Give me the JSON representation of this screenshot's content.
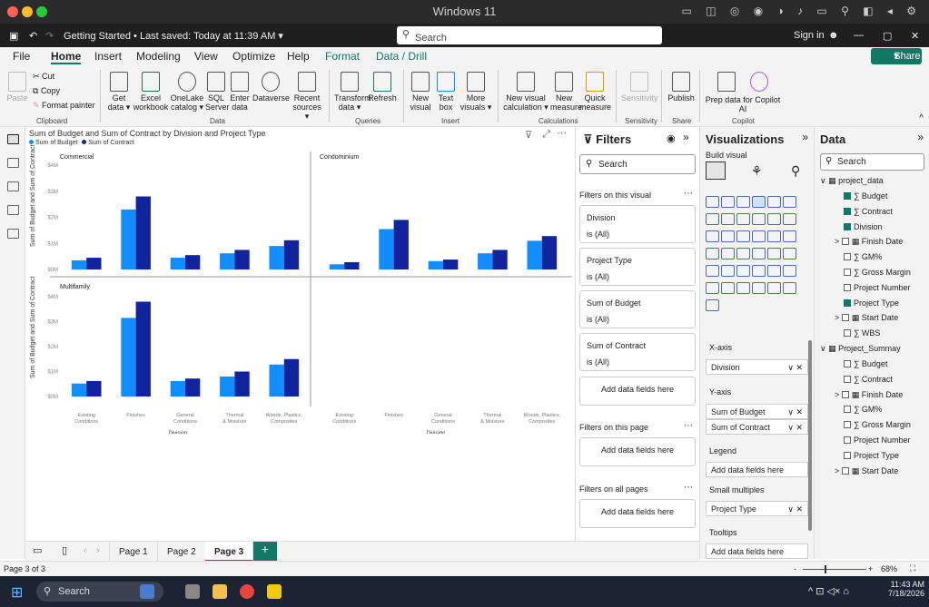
{
  "os": {
    "window_title": "Windows 11"
  },
  "title_bar": {
    "file_title": "Getting Started • Last saved: Today at 11:39 AM ▾",
    "search": "Search",
    "sign_in": "Sign in"
  },
  "menu": {
    "tabs": [
      "File",
      "Home",
      "Insert",
      "Modeling",
      "View",
      "Optimize",
      "Help",
      "Format",
      "Data / Drill"
    ],
    "share": "Share"
  },
  "ribbon": {
    "clipboard": {
      "paste": "Paste",
      "cut": "Cut",
      "copy": "Copy",
      "format_painter": "Format painter",
      "group": "Clipboard"
    },
    "data": {
      "get_data": "Get data ▾",
      "excel": "Excel workbook",
      "onelake": "OneLake catalog ▾",
      "sql": "SQL Server",
      "enter": "Enter data",
      "dataverse": "Dataverse",
      "recent": "Recent sources ▾",
      "group": "Data"
    },
    "queries": {
      "transform": "Transform data ▾",
      "refresh": "Refresh",
      "group": "Queries"
    },
    "insert": {
      "new_visual": "New visual",
      "text_box": "Text box",
      "more": "More visuals ▾",
      "group": "Insert"
    },
    "calcs": {
      "new_visual_calc": "New visual calculation ▾",
      "new_measure": "New measure",
      "quick_measure": "Quick measure",
      "group": "Calculations"
    },
    "sensitivity": {
      "label": "Sensitivity",
      "group": "Sensitivity"
    },
    "share": {
      "publish": "Publish",
      "group": "Share"
    },
    "copilot": {
      "prep": "Prep data for Copilot",
      "ai": "AI",
      "group": "Copilot"
    }
  },
  "chart_data": {
    "type": "bar",
    "title": "Sum of Budget and Sum of Contract by Division and Project Type",
    "ylabel": "Sum of Budget and Sum of Contract",
    "xlabel": "Division",
    "ylim": [
      0,
      4
    ],
    "yticks": [
      "$0M",
      "$1M",
      "$2M",
      "$3M",
      "$4M"
    ],
    "categories": [
      "Existing Conditions",
      "Finishes",
      "General Conditions",
      "Thermal & Moisture",
      "Woods, Plastics, Composites"
    ],
    "series_names": [
      "Sum of Budget",
      "Sum of Contract"
    ],
    "colors": [
      "#118dff",
      "#12239e"
    ],
    "panels": [
      {
        "name": "Commercial",
        "budget": [
          0.35,
          2.3,
          0.45,
          0.62,
          0.9
        ],
        "contract": [
          0.45,
          2.8,
          0.55,
          0.75,
          1.12
        ]
      },
      {
        "name": "Condominium",
        "budget": [
          0.2,
          1.55,
          0.32,
          0.62,
          1.1
        ],
        "contract": [
          0.28,
          1.9,
          0.38,
          0.75,
          1.28
        ]
      },
      {
        "name": "Multifamily",
        "budget": [
          0.52,
          3.15,
          0.62,
          0.8,
          1.28
        ],
        "contract": [
          0.62,
          3.8,
          0.72,
          1.0,
          1.5
        ]
      }
    ]
  },
  "filters": {
    "title": "Filters",
    "on_visual": "Filters on this visual",
    "cards": [
      {
        "name": "Division",
        "value": "is (All)"
      },
      {
        "name": "Project Type",
        "value": "is (All)"
      },
      {
        "name": "Sum of Budget",
        "value": "is (All)"
      },
      {
        "name": "Sum of Contract",
        "value": "is (All)"
      }
    ],
    "add": "Add data fields here",
    "on_page": "Filters on this page",
    "on_all": "Filters on all pages",
    "search": "Search"
  },
  "visualizations": {
    "title": "Visualizations",
    "build": "Build visual",
    "xaxis": "X-axis",
    "xaxis_field": "Division",
    "yaxis": "Y-axis",
    "y1": "Sum of Budget",
    "y2": "Sum of Contract",
    "legend": "Legend",
    "add": "Add data fields here",
    "small_multiples": "Small multiples",
    "sm_field": "Project Type",
    "tooltips": "Tooltips",
    "add2": "Add data fields here"
  },
  "data": {
    "title": "Data",
    "search": "Search",
    "tables": [
      {
        "name": "project_data",
        "fields": [
          {
            "label": "∑ Budget",
            "checked": true
          },
          {
            "label": "∑ Contract",
            "checked": true
          },
          {
            "label": "Division",
            "checked": true
          },
          {
            "label": "Finish Date",
            "checked": false,
            "expand": true
          },
          {
            "label": "∑ GM%",
            "checked": false
          },
          {
            "label": "∑ Gross Margin",
            "checked": false
          },
          {
            "label": "Project Number",
            "checked": false
          },
          {
            "label": "Project Type",
            "checked": true
          },
          {
            "label": "Start Date",
            "checked": false,
            "expand": true
          },
          {
            "label": "∑ WBS",
            "checked": false
          }
        ]
      },
      {
        "name": "Project_Summay",
        "fields": [
          {
            "label": "∑ Budget",
            "checked": false
          },
          {
            "label": "∑ Contract",
            "checked": false
          },
          {
            "label": "Finish Date",
            "checked": false,
            "expand": true
          },
          {
            "label": "∑ GM%",
            "checked": false
          },
          {
            "label": "∑ Gross Margin",
            "checked": false
          },
          {
            "label": "Project Number",
            "checked": false
          },
          {
            "label": "Project Type",
            "checked": false
          },
          {
            "label": "Start Date",
            "checked": false,
            "expand": true
          }
        ]
      }
    ]
  },
  "pages": {
    "tabs": [
      "Page 1",
      "Page 2",
      "Page 3"
    ],
    "active": "Page 3"
  },
  "status": {
    "page": "Page 3 of 3",
    "zoom": "68%"
  },
  "taskbar": {
    "search": "Search",
    "time": "11:43 AM",
    "date": "7/18/2026"
  }
}
